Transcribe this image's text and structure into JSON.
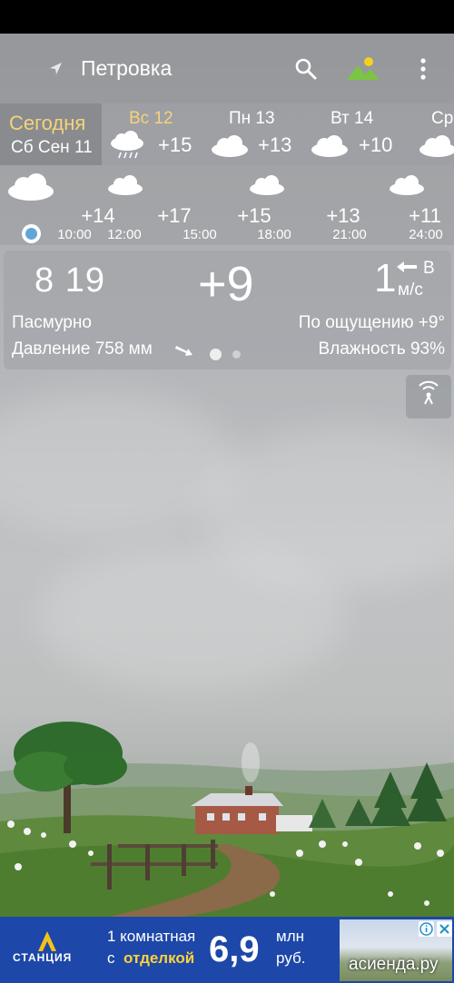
{
  "header": {
    "location": "Петровка",
    "icons": [
      "location-arrow-icon",
      "search-icon",
      "landscape-picker-icon",
      "more-vert-icon"
    ]
  },
  "days": [
    {
      "name": "Сегодня",
      "date": "Сб Сен 11",
      "selected": true
    },
    {
      "name": "Вс 12",
      "temp": "+15",
      "icon": "rain-cloud-icon",
      "highlight_color": "#f5d37a"
    },
    {
      "name": "Пн 13",
      "temp": "+13",
      "icon": "cloud-icon"
    },
    {
      "name": "Вт 14",
      "temp": "+10",
      "icon": "cloud-icon"
    },
    {
      "name": "Ср",
      "icon": "cloud-icon"
    }
  ],
  "hourly": [
    {
      "temp": "+14",
      "time": "10:00"
    },
    {
      "temp": "",
      "time": "12:00"
    },
    {
      "temp": "+17",
      "time": "15:00"
    },
    {
      "temp": "+15",
      "time": "18:00"
    },
    {
      "temp": "+13",
      "time": "21:00"
    },
    {
      "temp": "+11",
      "time": "24:00"
    }
  ],
  "current": {
    "clock": "8 19",
    "temp": "+9",
    "wind_speed": "1",
    "wind_dir": "В",
    "wind_unit": "м/с",
    "condition": "Пасмурно",
    "feels_like": "По ощущению +9°",
    "pressure": "Давление 758 мм",
    "humidity": "Влажность 93%"
  },
  "ad": {
    "brand": "СТАНЦИЯ",
    "line1": "1 комнатная",
    "line2_prefix": "с",
    "line2_bold": "отделкой",
    "price": "6,9",
    "unit1": "млн",
    "unit2": "руб.",
    "domain": "асиенда.ру"
  },
  "colors": {
    "accent_today": "#f5d37a",
    "now_dot": "#63a6d6",
    "ad_bg": "#1d47a8"
  }
}
